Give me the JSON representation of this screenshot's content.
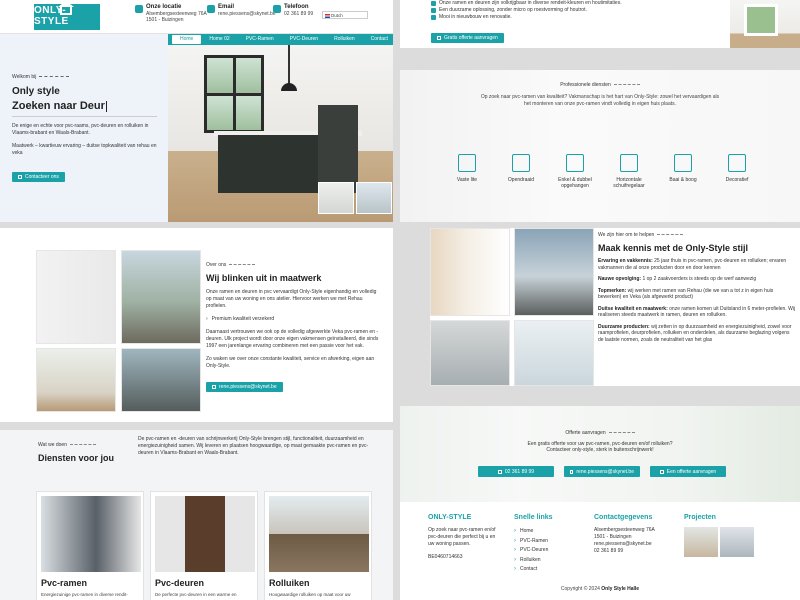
{
  "header": {
    "logo_text": "ONLY-STYLE",
    "location_title": "Onze locatie",
    "location_line1": "Alsembergsesteenweg 76A",
    "location_line2": "1501 - Buizingen",
    "email_title": "Email",
    "email_value": "rene.piessens@skynet.be",
    "phone_title": "Telefoon",
    "phone_value": "02 361 89 99",
    "language": "Dutch"
  },
  "nav": [
    "Home",
    "Home 02",
    "PVC-Ramen",
    "PVC-Deuren",
    "Rolluiken",
    "Contact"
  ],
  "hero": {
    "eyebrow": "Welkom bij",
    "title1": "Only style",
    "title2": "Zoeken naar Deur",
    "para1": "De enige en echte voor pvc-raams, pvc-deuren en rolluiken in Vlaams-brabant en Waals-Brabant.",
    "para2": "Maatwerk – kwartieuw ervaring – duitse topkwaliteit van rehau en veka",
    "button": "Contacteer ons"
  },
  "top_checks": [
    "Onze ramen en deuren zijn volkrijgbaar in diverse rendeit-kleuren en houtimitaties.",
    "Een duurzame oplossing, zonder micro op roestvorming of houtrot.",
    "Mooi in nieuwbouw en renovatie."
  ],
  "top_button": "Gratis offerte aanvragen",
  "services_intro": {
    "eyebrow": "Professionele diensten",
    "text": "Op zoek naar pvc-ramen van kwaliteit? Vakmanschap is het hart van Only-Style: zowel het vervaardigen als het monteren van onze pvc-ramen vindt volledig in eigen huis plaats.",
    "icons": [
      "Vaste lite",
      "Opendraaid",
      "Enkel & dubbel opgehangen",
      "Horizontale schuifregelaar",
      "Baai & boog",
      "Decoratief"
    ]
  },
  "maatwerk": {
    "eyebrow": "Over ons",
    "title": "Wij blinken uit in maatwerk",
    "para1": "Onze ramen en deuren in pvc vervaardigt Only-Style eigenhandig en volledig op maat van uw woning en ons atelier. Hiervoor werken we met Rehau profielen.",
    "check": "Premium kwaliteit verzekerd",
    "para2": "Daarnaast vertrouwen we ook op de volledig afgewerkte Veka pvc-ramen en -deuren. Ulk project wordt door onze eigen vakmensen geïnstalleerd, die sinds 1997 een jarenlange ervaring combineren met een passie voor het vak.",
    "para3": "Zo waken we over onze constante kwaliteit, service en afwerking, eigen aan Only-Style.",
    "button": "rene.piessens@skynet.be"
  },
  "kennis": {
    "eyebrow": "We zijn hier om te helpen",
    "title": "Maak kennis met de Only-Style stijl",
    "items": [
      {
        "label": "Ervaring en vakkennis:",
        "text": "25 jaar thuis in pvc-ramen, pvc-deuren en rolluiken; ervaren vakmannen die al onze producten door en door kennen"
      },
      {
        "label": "Nauwe opvolging:",
        "text": "1 op 2 zaakvoerders is steeds op de werf aanwezig"
      },
      {
        "label": "Topmerken:",
        "text": "wij werken met ramen van Rehau (die we van a tot z in eigen huis bewerken) en Veka (als afgewerkt product)"
      },
      {
        "label": "Duitse kwaliteit en maatwerk:",
        "text": "onze ramen komen uit Duitsland in 6 meter-profielen. Wij realiseren steeds maatwerk in ramen, deuren en rolluiken."
      },
      {
        "label": "Duurzame producten:",
        "text": "wij zetten in op duurzaamheid en energiezuinigheid, zowel voor raamprofielen, deurprofielen, rolluiken en onderdelen, als duurzame beglazing volgens de laatste normen, zoals de neutraliteit van het glas"
      }
    ]
  },
  "diensten": {
    "eyebrow": "Wat we doen",
    "title": "Diensten voor jou",
    "text": "De pvc-ramen en -deuren van schrijnwerkerij Only-Style brengen stijl, functionaliteit, duurzaamheid en energiezuinigheid samen. Wij leveren en plaatsen hoogwaardige, op maat gemaakte pvc-ramen en pvc-deuren in Vlaams-Brabant en Waals-Brabant.",
    "cards": [
      {
        "title": "Pvc-ramen",
        "desc": "Energiezuinige pvc-ramen in diverse rendit-"
      },
      {
        "title": "Pvc-deuren",
        "desc": "De perfecte pvc-deuren in een warme en"
      },
      {
        "title": "Rolluiken",
        "desc": "Hoogwaardige rolluiken op maat voor uw"
      }
    ]
  },
  "offerte": {
    "eyebrow": "Offerte aanvragen",
    "text1": "Een gratis offerte voor uw pvc-ramen, pvc-deuren en/of rolluiken?",
    "text2": "Contacteer only-style, sterk in buitenschrijnwerk!",
    "btn_phone": "02 361 89 99",
    "btn_email": "rene.piessens@skynet.be",
    "btn_offer": "Een offerte aanvragen"
  },
  "footer": {
    "logo": "ONLY-STYLE",
    "about": "Op zoek naar pvc-ramen en/of pvc-deuren die perfect bij u en uw woning passen.",
    "vat": "BE0460714663",
    "links_title": "Snelle links",
    "links": [
      "Home",
      "PVC-Ramen",
      "PVC-Deuren",
      "Rolluiken",
      "Contact"
    ],
    "contact_title": "Contactgegevens",
    "address1": "Alsembergsesteenweg 76A",
    "address2": "1501 - Buizingen",
    "email": "rene.piessens@skynet.be",
    "phone": "02 361 89 99",
    "projects_title": "Projecten",
    "copyright_prefix": "Copyright © 2024",
    "copyright_brand": "Only Style Halle"
  },
  "colors": {
    "accent": "#1aa2a8"
  }
}
